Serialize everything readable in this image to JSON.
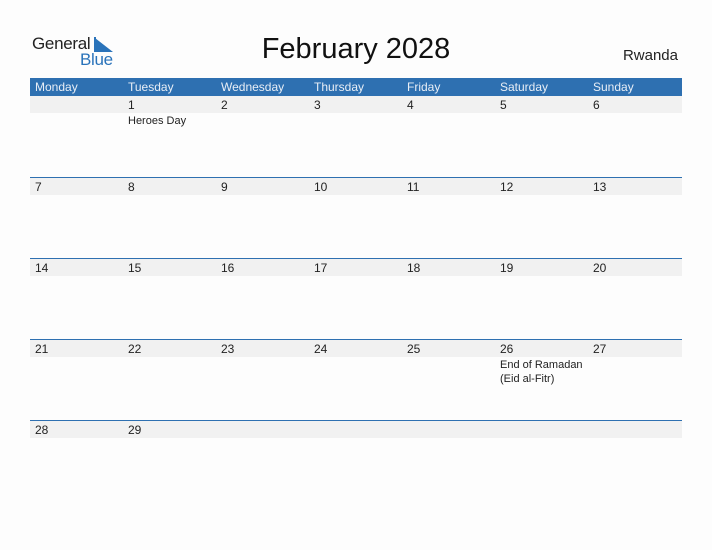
{
  "logo": {
    "word1": "General",
    "word2": "Blue",
    "icon": "triangle-flag-icon"
  },
  "title": "February 2028",
  "country": "Rwanda",
  "colors": {
    "header_bg": "#2e70b1",
    "stripe_bg": "#f1f1f1",
    "brand_blue": "#2a73ba"
  },
  "weekdays": [
    "Monday",
    "Tuesday",
    "Wednesday",
    "Thursday",
    "Friday",
    "Saturday",
    "Sunday"
  ],
  "weeks": [
    {
      "days": [
        {
          "n": "",
          "e": ""
        },
        {
          "n": "1",
          "e": "Heroes Day"
        },
        {
          "n": "2",
          "e": ""
        },
        {
          "n": "3",
          "e": ""
        },
        {
          "n": "4",
          "e": ""
        },
        {
          "n": "5",
          "e": ""
        },
        {
          "n": "6",
          "e": ""
        }
      ]
    },
    {
      "days": [
        {
          "n": "7",
          "e": ""
        },
        {
          "n": "8",
          "e": ""
        },
        {
          "n": "9",
          "e": ""
        },
        {
          "n": "10",
          "e": ""
        },
        {
          "n": "11",
          "e": ""
        },
        {
          "n": "12",
          "e": ""
        },
        {
          "n": "13",
          "e": ""
        }
      ]
    },
    {
      "days": [
        {
          "n": "14",
          "e": ""
        },
        {
          "n": "15",
          "e": ""
        },
        {
          "n": "16",
          "e": ""
        },
        {
          "n": "17",
          "e": ""
        },
        {
          "n": "18",
          "e": ""
        },
        {
          "n": "19",
          "e": ""
        },
        {
          "n": "20",
          "e": ""
        }
      ]
    },
    {
      "days": [
        {
          "n": "21",
          "e": ""
        },
        {
          "n": "22",
          "e": ""
        },
        {
          "n": "23",
          "e": ""
        },
        {
          "n": "24",
          "e": ""
        },
        {
          "n": "25",
          "e": ""
        },
        {
          "n": "26",
          "e": "End of Ramadan (Eid al-Fitr)"
        },
        {
          "n": "27",
          "e": ""
        }
      ]
    },
    {
      "days": [
        {
          "n": "28",
          "e": ""
        },
        {
          "n": "29",
          "e": ""
        },
        {
          "n": "",
          "e": ""
        },
        {
          "n": "",
          "e": ""
        },
        {
          "n": "",
          "e": ""
        },
        {
          "n": "",
          "e": ""
        },
        {
          "n": "",
          "e": ""
        }
      ]
    }
  ]
}
